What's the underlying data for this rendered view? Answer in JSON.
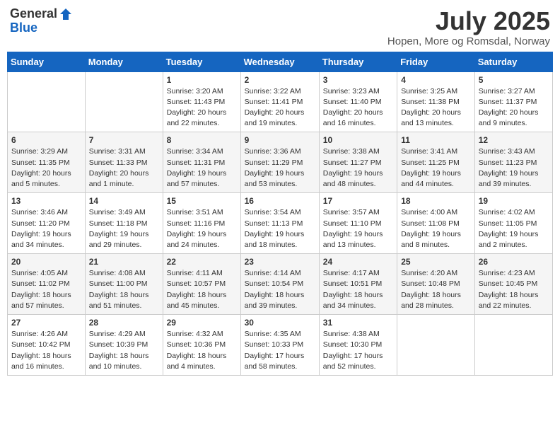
{
  "header": {
    "logo_general": "General",
    "logo_blue": "Blue",
    "month": "July 2025",
    "location": "Hopen, More og Romsdal, Norway"
  },
  "weekdays": [
    "Sunday",
    "Monday",
    "Tuesday",
    "Wednesday",
    "Thursday",
    "Friday",
    "Saturday"
  ],
  "weeks": [
    [
      {
        "day": "",
        "sunrise": "",
        "sunset": "",
        "daylight": ""
      },
      {
        "day": "",
        "sunrise": "",
        "sunset": "",
        "daylight": ""
      },
      {
        "day": "1",
        "sunrise": "Sunrise: 3:20 AM",
        "sunset": "Sunset: 11:43 PM",
        "daylight": "Daylight: 20 hours and 22 minutes."
      },
      {
        "day": "2",
        "sunrise": "Sunrise: 3:22 AM",
        "sunset": "Sunset: 11:41 PM",
        "daylight": "Daylight: 20 hours and 19 minutes."
      },
      {
        "day": "3",
        "sunrise": "Sunrise: 3:23 AM",
        "sunset": "Sunset: 11:40 PM",
        "daylight": "Daylight: 20 hours and 16 minutes."
      },
      {
        "day": "4",
        "sunrise": "Sunrise: 3:25 AM",
        "sunset": "Sunset: 11:38 PM",
        "daylight": "Daylight: 20 hours and 13 minutes."
      },
      {
        "day": "5",
        "sunrise": "Sunrise: 3:27 AM",
        "sunset": "Sunset: 11:37 PM",
        "daylight": "Daylight: 20 hours and 9 minutes."
      }
    ],
    [
      {
        "day": "6",
        "sunrise": "Sunrise: 3:29 AM",
        "sunset": "Sunset: 11:35 PM",
        "daylight": "Daylight: 20 hours and 5 minutes."
      },
      {
        "day": "7",
        "sunrise": "Sunrise: 3:31 AM",
        "sunset": "Sunset: 11:33 PM",
        "daylight": "Daylight: 20 hours and 1 minute."
      },
      {
        "day": "8",
        "sunrise": "Sunrise: 3:34 AM",
        "sunset": "Sunset: 11:31 PM",
        "daylight": "Daylight: 19 hours and 57 minutes."
      },
      {
        "day": "9",
        "sunrise": "Sunrise: 3:36 AM",
        "sunset": "Sunset: 11:29 PM",
        "daylight": "Daylight: 19 hours and 53 minutes."
      },
      {
        "day": "10",
        "sunrise": "Sunrise: 3:38 AM",
        "sunset": "Sunset: 11:27 PM",
        "daylight": "Daylight: 19 hours and 48 minutes."
      },
      {
        "day": "11",
        "sunrise": "Sunrise: 3:41 AM",
        "sunset": "Sunset: 11:25 PM",
        "daylight": "Daylight: 19 hours and 44 minutes."
      },
      {
        "day": "12",
        "sunrise": "Sunrise: 3:43 AM",
        "sunset": "Sunset: 11:23 PM",
        "daylight": "Daylight: 19 hours and 39 minutes."
      }
    ],
    [
      {
        "day": "13",
        "sunrise": "Sunrise: 3:46 AM",
        "sunset": "Sunset: 11:20 PM",
        "daylight": "Daylight: 19 hours and 34 minutes."
      },
      {
        "day": "14",
        "sunrise": "Sunrise: 3:49 AM",
        "sunset": "Sunset: 11:18 PM",
        "daylight": "Daylight: 19 hours and 29 minutes."
      },
      {
        "day": "15",
        "sunrise": "Sunrise: 3:51 AM",
        "sunset": "Sunset: 11:16 PM",
        "daylight": "Daylight: 19 hours and 24 minutes."
      },
      {
        "day": "16",
        "sunrise": "Sunrise: 3:54 AM",
        "sunset": "Sunset: 11:13 PM",
        "daylight": "Daylight: 19 hours and 18 minutes."
      },
      {
        "day": "17",
        "sunrise": "Sunrise: 3:57 AM",
        "sunset": "Sunset: 11:10 PM",
        "daylight": "Daylight: 19 hours and 13 minutes."
      },
      {
        "day": "18",
        "sunrise": "Sunrise: 4:00 AM",
        "sunset": "Sunset: 11:08 PM",
        "daylight": "Daylight: 19 hours and 8 minutes."
      },
      {
        "day": "19",
        "sunrise": "Sunrise: 4:02 AM",
        "sunset": "Sunset: 11:05 PM",
        "daylight": "Daylight: 19 hours and 2 minutes."
      }
    ],
    [
      {
        "day": "20",
        "sunrise": "Sunrise: 4:05 AM",
        "sunset": "Sunset: 11:02 PM",
        "daylight": "Daylight: 18 hours and 57 minutes."
      },
      {
        "day": "21",
        "sunrise": "Sunrise: 4:08 AM",
        "sunset": "Sunset: 11:00 PM",
        "daylight": "Daylight: 18 hours and 51 minutes."
      },
      {
        "day": "22",
        "sunrise": "Sunrise: 4:11 AM",
        "sunset": "Sunset: 10:57 PM",
        "daylight": "Daylight: 18 hours and 45 minutes."
      },
      {
        "day": "23",
        "sunrise": "Sunrise: 4:14 AM",
        "sunset": "Sunset: 10:54 PM",
        "daylight": "Daylight: 18 hours and 39 minutes."
      },
      {
        "day": "24",
        "sunrise": "Sunrise: 4:17 AM",
        "sunset": "Sunset: 10:51 PM",
        "daylight": "Daylight: 18 hours and 34 minutes."
      },
      {
        "day": "25",
        "sunrise": "Sunrise: 4:20 AM",
        "sunset": "Sunset: 10:48 PM",
        "daylight": "Daylight: 18 hours and 28 minutes."
      },
      {
        "day": "26",
        "sunrise": "Sunrise: 4:23 AM",
        "sunset": "Sunset: 10:45 PM",
        "daylight": "Daylight: 18 hours and 22 minutes."
      }
    ],
    [
      {
        "day": "27",
        "sunrise": "Sunrise: 4:26 AM",
        "sunset": "Sunset: 10:42 PM",
        "daylight": "Daylight: 18 hours and 16 minutes."
      },
      {
        "day": "28",
        "sunrise": "Sunrise: 4:29 AM",
        "sunset": "Sunset: 10:39 PM",
        "daylight": "Daylight: 18 hours and 10 minutes."
      },
      {
        "day": "29",
        "sunrise": "Sunrise: 4:32 AM",
        "sunset": "Sunset: 10:36 PM",
        "daylight": "Daylight: 18 hours and 4 minutes."
      },
      {
        "day": "30",
        "sunrise": "Sunrise: 4:35 AM",
        "sunset": "Sunset: 10:33 PM",
        "daylight": "Daylight: 17 hours and 58 minutes."
      },
      {
        "day": "31",
        "sunrise": "Sunrise: 4:38 AM",
        "sunset": "Sunset: 10:30 PM",
        "daylight": "Daylight: 17 hours and 52 minutes."
      },
      {
        "day": "",
        "sunrise": "",
        "sunset": "",
        "daylight": ""
      },
      {
        "day": "",
        "sunrise": "",
        "sunset": "",
        "daylight": ""
      }
    ]
  ]
}
